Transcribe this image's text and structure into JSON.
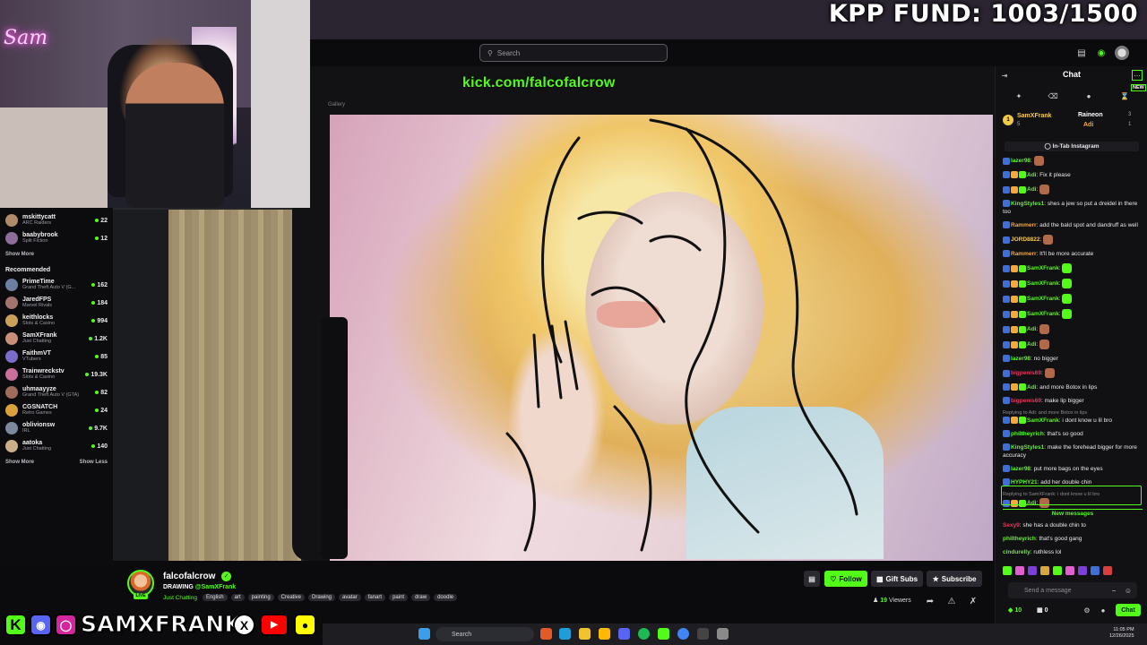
{
  "overlay": {
    "fund_text": "KPP FUND: 1003/1500",
    "neon_sign": "Sam",
    "social_handle": "SAMXFRANK",
    "social_icons": [
      "kick-icon",
      "discord-icon",
      "instagram-icon",
      "x-icon",
      "youtube-icon",
      "snapchat-icon"
    ]
  },
  "header": {
    "search_placeholder": "Search"
  },
  "sidebar": {
    "following": [
      {
        "name": "mskittycatt",
        "category": "ARC Raiders",
        "viewers": "22",
        "color": "#b08a6a"
      },
      {
        "name": "baabybrook",
        "category": "Split Fiction",
        "viewers": "12",
        "color": "#8d6d9a"
      }
    ],
    "show_more_1": "Show More",
    "recommended_title": "Recommended",
    "recommended": [
      {
        "name": "PrimeTime",
        "category": "Grand Theft Auto V (G...",
        "viewers": "162",
        "color": "#6d7fa1"
      },
      {
        "name": "JaredFPS",
        "category": "Marvel Rivals",
        "viewers": "184",
        "color": "#a1756d"
      },
      {
        "name": "keithlocks",
        "category": "Slots & Casino",
        "viewers": "994",
        "color": "#c9a15a"
      },
      {
        "name": "SamXFrank",
        "category": "Just Chatting",
        "viewers": "1.2K",
        "color": "#c98f7a"
      },
      {
        "name": "FaithmVT",
        "category": "VTubers",
        "viewers": "85",
        "color": "#7a6dc9"
      },
      {
        "name": "Trainwreckstv",
        "category": "Slots & Casino",
        "viewers": "19.3K",
        "color": "#c96d9b"
      },
      {
        "name": "uhmaayyze",
        "category": "Grand Theft Auto V (GTA)",
        "viewers": "82",
        "color": "#9b6d5a"
      },
      {
        "name": "CGSNATCH",
        "category": "Retro Games",
        "viewers": "24",
        "color": "#d9a23a"
      },
      {
        "name": "oblivionsw",
        "category": "IRL",
        "viewers": "9.7K",
        "color": "#7a8a9b"
      },
      {
        "name": "aatoka",
        "category": "Just Chatting",
        "viewers": "140",
        "color": "#c9b08a"
      }
    ],
    "show_more_2": "Show More",
    "show_less": "Show Less"
  },
  "video": {
    "overlay_url": "kick.com/falcofalcrow",
    "toolbar_label": "Gallery"
  },
  "stream": {
    "streamer": "falcofalcrow",
    "live_label": "LIVE",
    "title_prefix": "DRAWING",
    "title_mention": "@SamXFrank",
    "category": "Just Chatting",
    "tags": [
      "English",
      "art",
      "painting",
      "Creative",
      "Drawing",
      "avatar",
      "fanart",
      "paint",
      "draw",
      "doodle"
    ],
    "follow_label": "Follow",
    "gift_label": "Gift Subs",
    "subscribe_label": "Subscribe",
    "viewers_count": "19",
    "viewers_label": "Viewers"
  },
  "chat": {
    "title": "Chat",
    "new_badge": "NEW",
    "leaderboard": {
      "first_name": "SamXFrank",
      "first_count": "5",
      "second_name": "Raineon",
      "second_count": "3",
      "third_name": "Adi",
      "third_count": "1"
    },
    "pinned": "In-Tab Instagram",
    "messages": [
      {
        "user": "lazer98",
        "color": "#53fc18",
        "text": "",
        "reply": ""
      },
      {
        "user": "Adi",
        "color": "#53fc18",
        "text": "Fix it please",
        "reply": ""
      },
      {
        "user": "Adi",
        "color": "#53fc18",
        "text": "",
        "reply": ""
      },
      {
        "user": "KingStyles1",
        "color": "#53fc18",
        "text": "shes a jew so put a dreidel in there too",
        "reply": ""
      },
      {
        "user": "Rammerr",
        "color": "#f3a93b",
        "text": "add the bald spot and dandruff as well",
        "reply": ""
      },
      {
        "user": "JORD8822",
        "color": "#f3c94b",
        "text": "",
        "reply": ""
      },
      {
        "user": "Rammerr",
        "color": "#f3a93b",
        "text": "It'll be more accurate",
        "reply": ""
      },
      {
        "user": "SamXFrank",
        "color": "#53fc18",
        "text": "",
        "reply": ""
      },
      {
        "user": "SamXFrank",
        "color": "#53fc18",
        "text": "",
        "reply": ""
      },
      {
        "user": "SamXFrank",
        "color": "#53fc18",
        "text": "",
        "reply": ""
      },
      {
        "user": "SamXFrank",
        "color": "#53fc18",
        "text": "",
        "reply": ""
      },
      {
        "user": "Adi",
        "color": "#53fc18",
        "text": "",
        "reply": ""
      },
      {
        "user": "Adi",
        "color": "#53fc18",
        "text": "",
        "reply": ""
      },
      {
        "user": "lazer98",
        "color": "#53fc18",
        "text": "no bigger",
        "reply": ""
      },
      {
        "user": "bigpenis69",
        "color": "#e03a5c",
        "text": "",
        "reply": ""
      },
      {
        "user": "Adi",
        "color": "#53fc18",
        "text": "and more Botox in lips",
        "reply": ""
      },
      {
        "user": "bigpenis69",
        "color": "#e03a5c",
        "text": "make lip bigger",
        "reply": ""
      },
      {
        "user": "SamXFrank",
        "color": "#53fc18",
        "text": "i dont know u lil bro",
        "reply": "Replying to Adi: and more Botox in lips"
      },
      {
        "user": "philtheyrich",
        "color": "#53fc18",
        "text": "that's so good",
        "reply": ""
      },
      {
        "user": "KingStyles1",
        "color": "#53fc18",
        "text": "make the forehead bigger for more accuracy",
        "reply": ""
      },
      {
        "user": "lazer98",
        "color": "#53fc18",
        "text": "put more bags on the eyes",
        "reply": ""
      },
      {
        "user": "HYPHY21",
        "color": "#53fc18",
        "text": "add her double chin",
        "reply": ""
      },
      {
        "user": "Adi",
        "color": "#53fc18",
        "text": "",
        "reply": "Replying to SamXFrank: i dont know u lil bro"
      }
    ],
    "new_messages": "New messages",
    "recent": [
      {
        "user": "Sexy9",
        "color": "#e03a5c",
        "text": "she has a double chin to"
      },
      {
        "user": "philtheyrich",
        "color": "#53fc18",
        "text": "that's good gang"
      },
      {
        "user": "cindurelly",
        "color": "#53fc18",
        "text": "ruthless lol"
      }
    ],
    "input_placeholder": "Send a message",
    "points": "10",
    "gifts": "0",
    "chat_button": "Chat"
  },
  "taskbar": {
    "search_label": "Search",
    "time": "11:05 PM",
    "date": "12/26/2025"
  },
  "colors": {
    "accent": "#53fc18",
    "background": "#0b0b0d",
    "chat_bg": "#111114"
  }
}
